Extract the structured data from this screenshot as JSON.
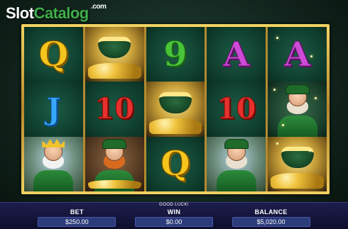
{
  "watermark": {
    "brand_part1": "Slot",
    "brand_part2": "Catalog",
    "domain_suffix": ".com"
  },
  "reels": [
    [
      {
        "type": "letter",
        "text": "Q",
        "color": "gold"
      },
      {
        "type": "letter",
        "text": "J",
        "color": "blue"
      },
      {
        "type": "image",
        "subject": "leprechaun-king-icon"
      }
    ],
    [
      {
        "type": "image",
        "subject": "pot-of-gold-icon"
      },
      {
        "type": "letter",
        "text": "10",
        "color": "red"
      },
      {
        "type": "image",
        "subject": "leprechaun-with-pint-icon"
      }
    ],
    [
      {
        "type": "letter",
        "text": "9",
        "color": "green"
      },
      {
        "type": "image",
        "subject": "pot-of-gold-icon"
      },
      {
        "type": "letter",
        "text": "Q",
        "color": "gold"
      }
    ],
    [
      {
        "type": "letter",
        "text": "A",
        "color": "purple"
      },
      {
        "type": "letter",
        "text": "10",
        "color": "red"
      },
      {
        "type": "image",
        "subject": "leprechaun-saluting-icon"
      }
    ],
    [
      {
        "type": "letter",
        "text": "A",
        "color": "purple"
      },
      {
        "type": "image",
        "subject": "leprechaun-saluting-icon"
      },
      {
        "type": "image",
        "subject": "pot-of-gold-icon"
      }
    ]
  ],
  "status_message": "GOOD LUCK!",
  "bottom_bar": {
    "bet": {
      "label": "BET",
      "value": "$250.00"
    },
    "win": {
      "label": "WIN",
      "value": "$0.00"
    },
    "balance": {
      "label": "BALANCE",
      "value": "$5,020.00"
    }
  },
  "colors": {
    "frame_gold": "#f3d463",
    "reel_green": "#0f3d2d",
    "bottom_bar": "#1d1d4d"
  }
}
